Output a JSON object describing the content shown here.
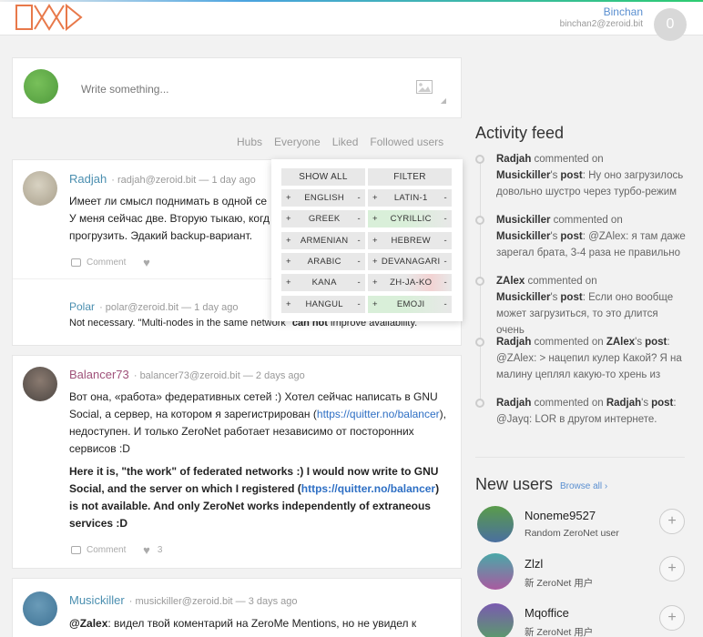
{
  "header": {
    "user_name": "Binchan",
    "user_address": "binchan2@zeroid.bit",
    "avatar_initial": "0"
  },
  "compose": {
    "placeholder": "Write something..."
  },
  "filters": [
    "Hubs",
    "Everyone",
    "Liked",
    "Followed users"
  ],
  "language_menu": {
    "show_all": "SHOW ALL",
    "filter": "FILTER",
    "languages": [
      {
        "name": "ENGLISH",
        "plus": "+",
        "minus": "-"
      },
      {
        "name": "LATIN-1",
        "plus": "+",
        "minus": "-"
      },
      {
        "name": "GREEK",
        "plus": "+",
        "minus": "-"
      },
      {
        "name": "CYRILLIC",
        "plus": "+",
        "minus": "-"
      },
      {
        "name": "ARMENIAN",
        "plus": "+",
        "minus": "-"
      },
      {
        "name": "HEBREW",
        "plus": "+",
        "minus": "-"
      },
      {
        "name": "ARABIC",
        "plus": "+",
        "minus": "-"
      },
      {
        "name": "DEVANAGARI",
        "plus": "+",
        "minus": "-"
      },
      {
        "name": "KANA",
        "plus": "+",
        "minus": "-"
      },
      {
        "name": "ZH-JA-KO",
        "plus": "+",
        "minus": "-"
      },
      {
        "name": "HANGUL",
        "plus": "+",
        "minus": "-"
      },
      {
        "name": "EMOJI",
        "plus": "+",
        "minus": "-"
      }
    ]
  },
  "posts": [
    {
      "author": "Radjah",
      "meta": "· radjah@zeroid.bit — 1 day ago",
      "lines": [
        "Имеет ли смысл поднимать в одной се",
        "У меня сейчас две. Вторую тыкаю, когд",
        "прогрузить. Эдакий backup-вариант."
      ],
      "comment_label": "Comment",
      "reply": {
        "author": "Polar",
        "meta": "· polar@zeroid.bit — 1 day ago",
        "text_before": "Not necessary. \"Multi-nodes in the same network\"",
        "text_bold": "can not",
        "text_after": "improve availability."
      }
    },
    {
      "author": "Balancer73",
      "meta": "· balancer73@zeroid.bit — 2 days ago",
      "p1_before": "Вот она, «работа» федеративных сетей :) Хотел сейчас написать в GNU Social, а сервер, на котором я зарегистрирован (",
      "p1_link": "https://quitter.no/balancer",
      "p1_after": "), недоступен. И только ZeroNet работает независимо от посторонних сервисов :D",
      "p2_before": "Here it is, \"the work\" of federated networks :) I would now write to GNU Social, and the server on which I registered (",
      "p2_link": "https://quitter.no/balancer",
      "p2_after": ") is not available. And only ZeroNet works independently of extraneous services :D",
      "comment_label": "Comment",
      "likes": "3"
    },
    {
      "author": "Musickiller",
      "meta": "· musickiller@zeroid.bit — 3 days ago",
      "mention": "@Zalex",
      "text": ": видел твой коментарий на ZeroMe Mentions, но не увидел к"
    }
  ],
  "activity": {
    "title": "Activity feed",
    "items": [
      {
        "actor": "Radjah",
        "verb": " commented on ",
        "target": "Musickiller",
        "suffix": "'s",
        "obj": "post",
        "text": ": Ну оно загрузилось довольно шустро через турбо-режим"
      },
      {
        "actor": "Musickiller",
        "verb": " commented on ",
        "target": "Musickiller",
        "suffix": "'s",
        "obj": "post",
        "text": ": @ZAlex: я там даже зарегал брата, 3-4 раза не правильно"
      },
      {
        "actor": "ZAlex",
        "verb": " commented on ",
        "target": "Musickiller",
        "suffix": "'s",
        "obj": "post",
        "text": ": Если оно вообще может загрузиться, то это длится очень"
      },
      {
        "actor": "Radjah",
        "verb": " commented on ",
        "target": "ZAlex",
        "suffix": "'s",
        "obj": "post",
        "text": ": @ZAlex: > нацепил кулер Какой? Я на малину цеплял какую-то хрень из"
      },
      {
        "actor": "Radjah",
        "verb": " commented on ",
        "target": "Radjah",
        "suffix": "'s",
        "obj": "post",
        "text": ": @Jayq: LOR в другом интернете."
      }
    ]
  },
  "new_users": {
    "title": "New users",
    "browse_label": "Browse all ›",
    "items": [
      {
        "name": "Noneme9527",
        "desc": "Random ZeroNet user",
        "add": "+"
      },
      {
        "name": "Zlzl",
        "desc": "新 ZeroNet 用户",
        "add": "+"
      },
      {
        "name": "Mqoffice",
        "desc": "新 ZeroNet 用户",
        "add": "+"
      }
    ]
  },
  "colors": {
    "accent_blue": "#5a8fd0",
    "author_teal": "#4b8fb0",
    "author_purple": "#a0527a",
    "link": "#2e6fc4"
  }
}
